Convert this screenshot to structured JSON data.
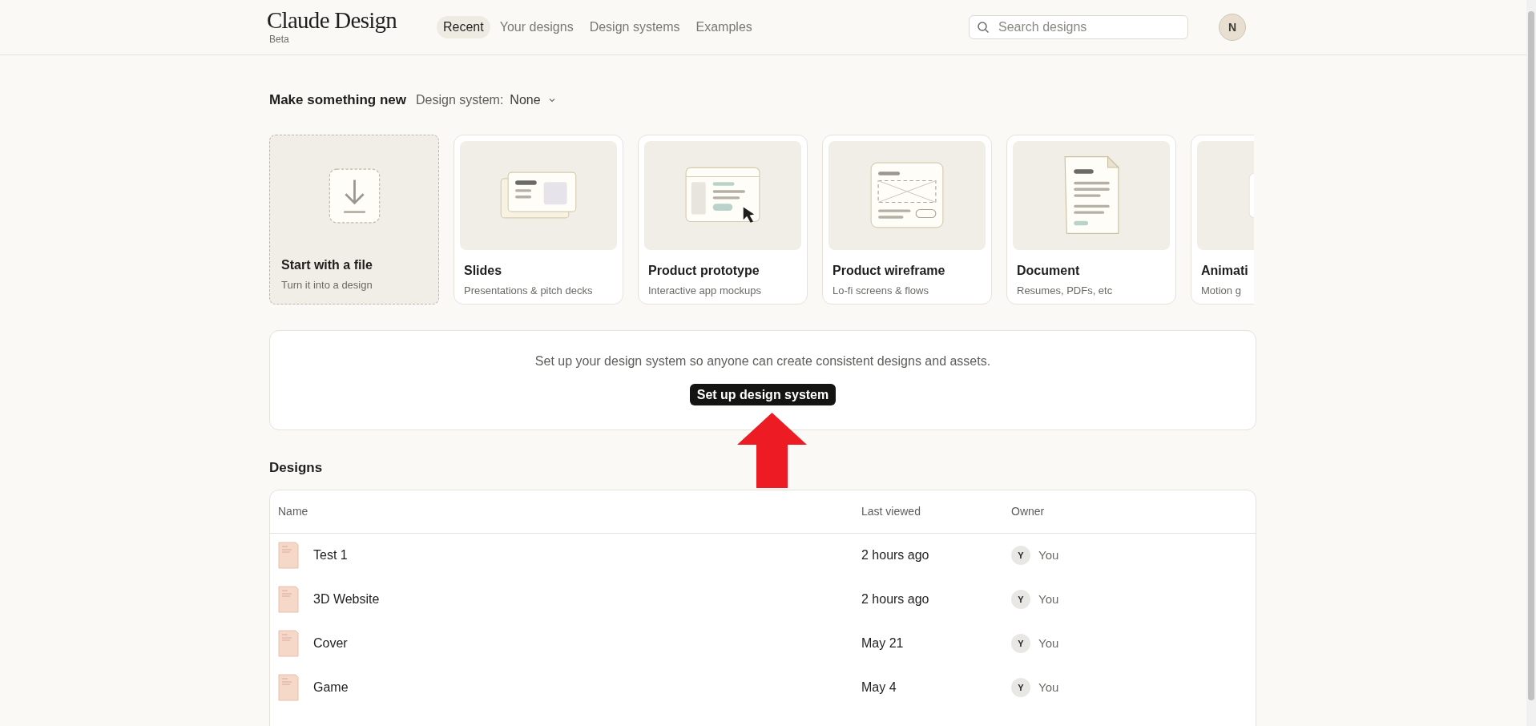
{
  "header": {
    "logo": "Claude Design",
    "badge": "Beta",
    "nav": [
      {
        "label": "Recent",
        "selected": true
      },
      {
        "label": "Your designs",
        "selected": false
      },
      {
        "label": "Design systems",
        "selected": false
      },
      {
        "label": "Examples",
        "selected": false
      }
    ],
    "search": {
      "placeholder": "Search designs"
    },
    "avatar": "N"
  },
  "make_new": {
    "title": "Make something new",
    "design_system_label": "Design system:",
    "design_system_value": "None",
    "cards": [
      {
        "kind": "file",
        "title": "Start with a file",
        "subtitle": "Turn it into a design"
      },
      {
        "kind": "slides",
        "title": "Slides",
        "subtitle": "Presentations & pitch decks"
      },
      {
        "kind": "prototype",
        "title": "Product prototype",
        "subtitle": "Interactive app mockups"
      },
      {
        "kind": "wireframe",
        "title": "Product wireframe",
        "subtitle": "Lo-fi screens & flows"
      },
      {
        "kind": "document",
        "title": "Document",
        "subtitle": "Resumes, PDFs, etc"
      },
      {
        "kind": "animation",
        "title": "Animati",
        "subtitle": "Motion g"
      }
    ]
  },
  "banner": {
    "text": "Set up your design system so anyone can create consistent designs and assets.",
    "button": "Set up design system"
  },
  "designs": {
    "title": "Designs",
    "columns": [
      "Name",
      "Last viewed",
      "Owner"
    ],
    "rows": [
      {
        "name": "Test 1",
        "last_viewed": "2 hours ago",
        "owner_initial": "Y",
        "owner": "You"
      },
      {
        "name": "3D Website",
        "last_viewed": "2 hours ago",
        "owner_initial": "Y",
        "owner": "You"
      },
      {
        "name": "Cover",
        "last_viewed": "May 21",
        "owner_initial": "Y",
        "owner": "You"
      },
      {
        "name": "Game",
        "last_viewed": "May 4",
        "owner_initial": "Y",
        "owner": "You"
      }
    ]
  }
}
